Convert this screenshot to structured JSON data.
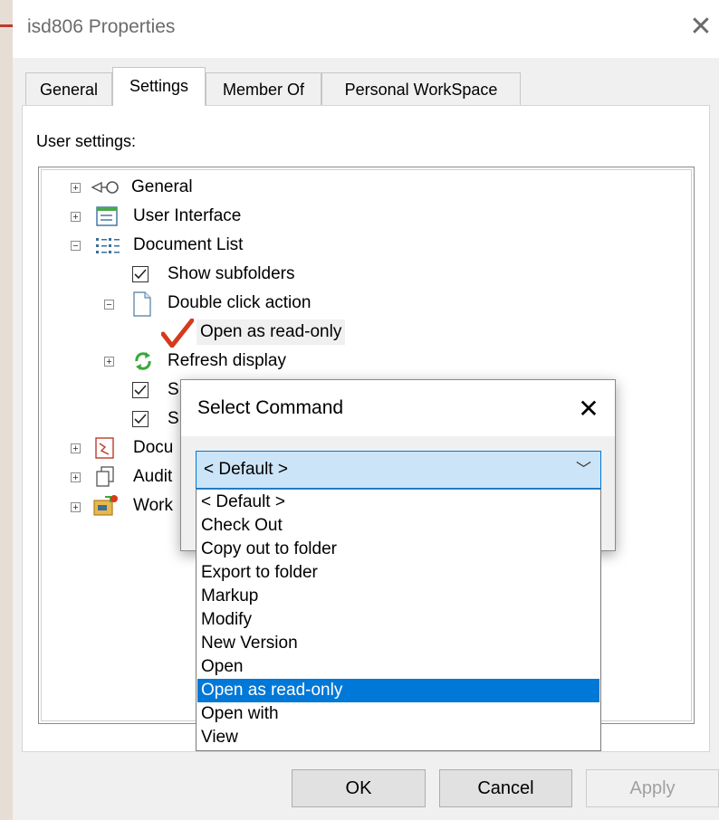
{
  "window": {
    "title": "isd806 Properties"
  },
  "tabs": [
    {
      "label": "General",
      "active": false
    },
    {
      "label": "Settings",
      "active": true
    },
    {
      "label": "Member Of",
      "active": false
    },
    {
      "label": "Personal WorkSpace",
      "active": false
    }
  ],
  "settings": {
    "label": "User settings:"
  },
  "tree": {
    "items": [
      {
        "label": "General",
        "icon": "key-icon",
        "expander": "+"
      },
      {
        "label": "User Interface",
        "icon": "window-icon",
        "expander": "+"
      },
      {
        "label": "Document List",
        "icon": "list-icon",
        "expander": "−"
      },
      {
        "label": "Show subfolders",
        "checked": true
      },
      {
        "label": "Double click action",
        "icon": "document-icon",
        "expander": "−"
      },
      {
        "label": "Open as read-only",
        "icon": "checkmark-icon"
      },
      {
        "label": "Refresh display",
        "icon": "refresh-icon",
        "expander": "+"
      },
      {
        "label": "S",
        "checked": true
      },
      {
        "label": "S",
        "checked": true
      },
      {
        "label": "Docu",
        "icon": "document-icon",
        "expander": "+"
      },
      {
        "label": "Audit",
        "icon": "copy-icon",
        "expander": "+"
      },
      {
        "label": "Work",
        "icon": "workspace-icon",
        "expander": "+"
      }
    ]
  },
  "dialog": {
    "title": "Select Command",
    "combo_value": "< Default >",
    "options": [
      "< Default >",
      "Check Out",
      "Copy out to folder",
      "Export to folder",
      "Markup",
      "Modify",
      "New Version",
      "Open",
      "Open as read-only",
      "Open with",
      "View"
    ],
    "selected_index": 8
  },
  "buttons": {
    "ok": "OK",
    "cancel": "Cancel",
    "apply": "Apply"
  },
  "colors": {
    "selection": "#0078d7",
    "combo_bg": "#cce4f7",
    "check_red": "#d63a1c"
  }
}
